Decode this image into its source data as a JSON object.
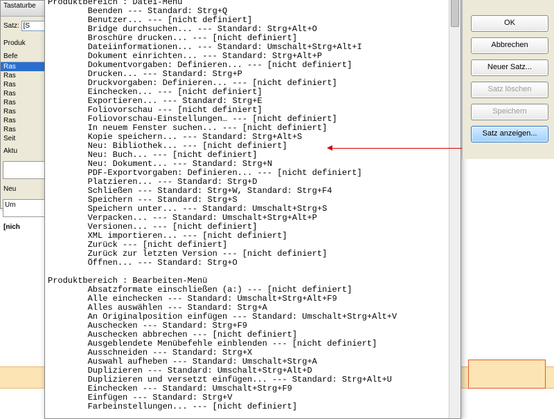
{
  "bgDialog": {
    "title": "Tastaturbe",
    "satzLabel": "Satz:",
    "satzValue": "[S",
    "produkLabel": "Produk",
    "befeLabel": "Befe",
    "items": [
      "Ras",
      "Ras",
      "Ras",
      "Ras",
      "Ras",
      "Ras",
      "Ras",
      "Ras",
      "Seit"
    ],
    "aktuLabel": "Aktu",
    "neuLabel": "Neu",
    "umValue": "Um",
    "nichLabel": "[nich"
  },
  "sections": [
    {
      "header": "Produktbereich : Datei-Menü",
      "items": [
        "Beenden --- Standard: Strg+Q",
        "Benutzer... --- [nicht definiert]",
        "Bridge durchsuchen... --- Standard: Strg+Alt+O",
        "Broschüre drucken... --- [nicht definiert]",
        "Dateiinformationen... --- Standard: Umschalt+Strg+Alt+I",
        "Dokument einrichten... --- Standard: Strg+Alt+P",
        "Dokumentvorgaben: Definieren... --- [nicht definiert]",
        "Drucken... --- Standard: Strg+P",
        "Druckvorgaben: Definieren... --- [nicht definiert]",
        "Einchecken... --- [nicht definiert]",
        "Exportieren... --- Standard: Strg+E",
        "Foliovorschau --- [nicht definiert]",
        "Foliovorschau-Einstellungen… --- [nicht definiert]",
        "In neuem Fenster suchen... --- [nicht definiert]",
        "Kopie speichern... --- Standard: Strg+Alt+S",
        "Neu: Bibliothek... --- [nicht definiert]",
        "Neu: Buch... --- [nicht definiert]",
        "Neu: Dokument... --- Standard: Strg+N",
        "PDF-Exportvorgaben: Definieren... --- [nicht definiert]",
        "Platzieren... --- Standard: Strg+D",
        "Schließen --- Standard: Strg+W, Standard: Strg+F4",
        "Speichern --- Standard: Strg+S",
        "Speichern unter... --- Standard: Umschalt+Strg+S",
        "Verpacken... --- Standard: Umschalt+Strg+Alt+P",
        "Versionen... --- [nicht definiert]",
        "XML importieren... --- [nicht definiert]",
        "Zurück --- [nicht definiert]",
        "Zurück zur letzten Version --- [nicht definiert]",
        "Öffnen... --- Standard: Strg+O"
      ]
    },
    {
      "header": "Produktbereich : Bearbeiten-Menü",
      "items": [
        "Absatzformate einschließen (a:) --- [nicht definiert]",
        "Alle einchecken --- Standard: Umschalt+Strg+Alt+F9",
        "Alles auswählen --- Standard: Strg+A",
        "An Originalposition einfügen --- Standard: Umschalt+Strg+Alt+V",
        "Auschecken --- Standard: Strg+F9",
        "Auschecken abbrechen --- [nicht definiert]",
        "Ausgeblendete Menübefehle einblenden --- [nicht definiert]",
        "Ausschneiden --- Standard: Strg+X",
        "Auswahl aufheben --- Standard: Umschalt+Strg+A",
        "Duplizieren --- Standard: Umschalt+Strg+Alt+D",
        "Duplizieren und versetzt einfügen... --- Standard: Strg+Alt+U",
        "Einchecken --- Standard: Umschalt+Strg+F9",
        "Einfügen --- Standard: Strg+V",
        "Farbeinstellungen... --- [nicht definiert]"
      ]
    }
  ],
  "buttons": {
    "ok": "OK",
    "cancel": "Abbrechen",
    "newSet": "Neuer Satz...",
    "deleteSet": "Satz löschen",
    "save": "Speichern",
    "showSet": "Satz anzeigen..."
  }
}
